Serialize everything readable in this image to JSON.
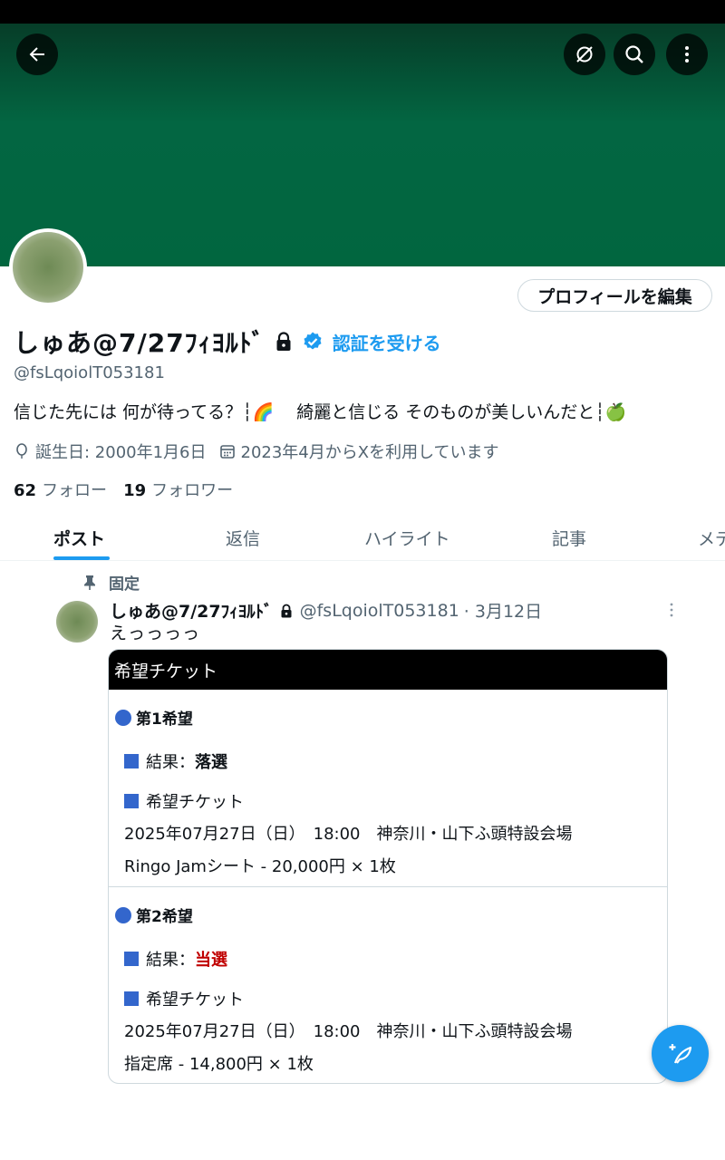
{
  "profile": {
    "edit_button": "プロフィールを編集",
    "display_name": "しゅあ@7/27ﾌｨﾖﾙﾄﾞ",
    "verify_link": "認証を受ける",
    "handle": "@fsLqoiolT053181",
    "bio": "信じた先には 何が待ってる？┆🌈　 綺麗と信じる そのものが美しいんだと┆🍏",
    "birthday": "誕生日: 2000年1月6日",
    "joined": "2023年4月からXを利用しています",
    "following_count": "62",
    "following_label": "フォロー",
    "followers_count": "19",
    "followers_label": "フォロワー",
    "banner_color": "#01663f",
    "accent_color": "#1d9bf0"
  },
  "tabs": [
    {
      "label": "ポスト",
      "active": true
    },
    {
      "label": "返信"
    },
    {
      "label": "ハイライト"
    },
    {
      "label": "記事"
    },
    {
      "label": "メディア"
    }
  ],
  "post": {
    "pinned_label": "固定",
    "name": "しゅあ@7/27ﾌｨﾖﾙﾄﾞ",
    "handle": "@fsLqoiolT053181",
    "date": "· 3月12日",
    "text": "えっっっっ",
    "ticket": {
      "header": "希望チケット",
      "choices": [
        {
          "title": "第1希望",
          "result_label": "結果：",
          "result": "落選",
          "ticket_label": "希望チケット",
          "datetime_venue": "2025年07月27日（日）　18:00　神奈川・山下ふ頭特設会場",
          "seat": "Ringo Jamシート - 20,000円 × 1枚"
        },
        {
          "title": "第2希望",
          "result_label": "結果：",
          "result": "当選",
          "ticket_label": "希望チケット",
          "datetime_venue": "2025年07月27日（日）　18:00　神奈川・山下ふ頭特設会場",
          "seat": "指定席 - 14,800円 × 1枚"
        }
      ]
    }
  },
  "icons": {
    "back": "back-arrow-icon",
    "circle_off": "circle-slash-icon",
    "search": "search-icon",
    "more": "more-vertical-icon",
    "compose": "compose-post-icon"
  }
}
